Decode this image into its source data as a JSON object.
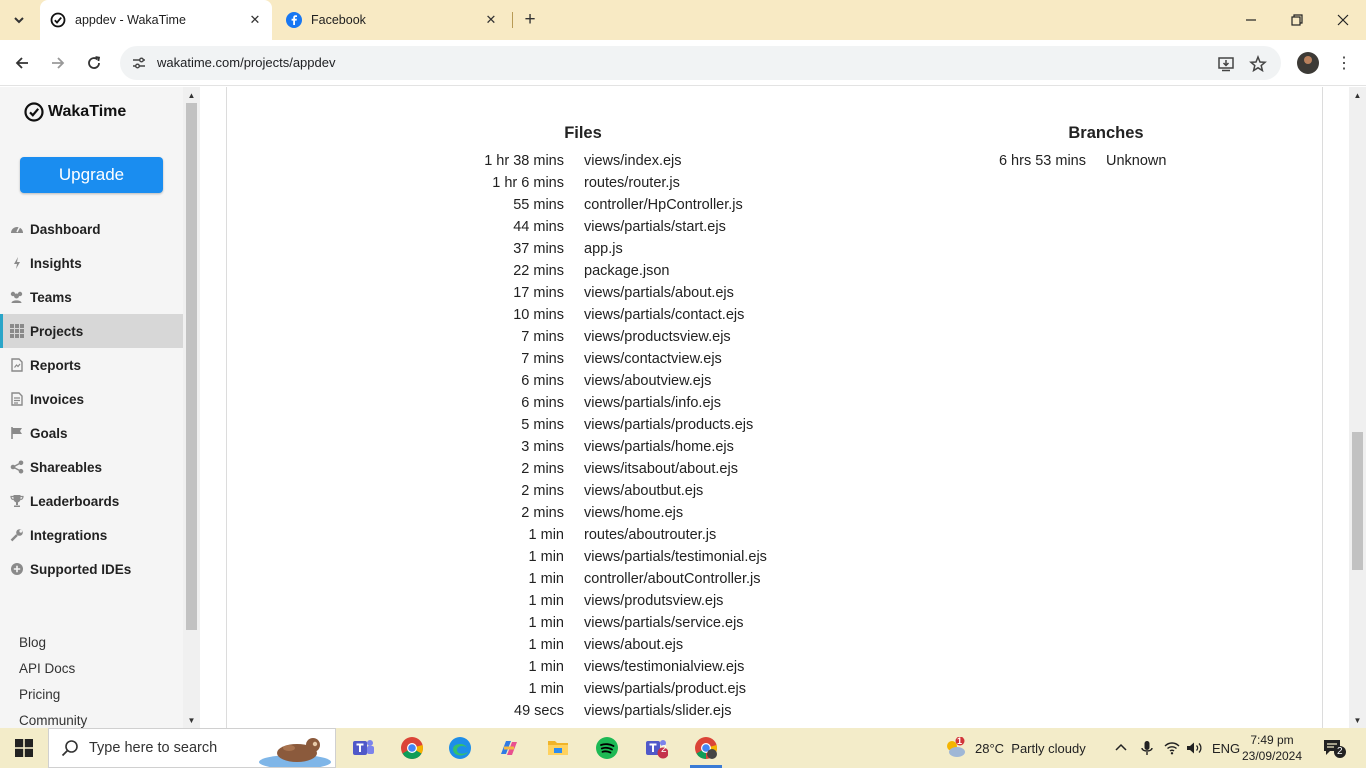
{
  "browser": {
    "tabs": [
      {
        "title": "appdev - WakaTime",
        "active": true
      },
      {
        "title": "Facebook",
        "active": false
      }
    ],
    "url": "wakatime.com/projects/appdev"
  },
  "sidebar": {
    "logo_text": "WakaTime",
    "upgrade_label": "Upgrade",
    "items": [
      {
        "label": "Dashboard",
        "icon": "dashboard-icon"
      },
      {
        "label": "Insights",
        "icon": "bolt-icon"
      },
      {
        "label": "Teams",
        "icon": "users-icon"
      },
      {
        "label": "Projects",
        "icon": "grid-icon",
        "active": true
      },
      {
        "label": "Reports",
        "icon": "report-icon"
      },
      {
        "label": "Invoices",
        "icon": "invoice-icon"
      },
      {
        "label": "Goals",
        "icon": "flag-icon"
      },
      {
        "label": "Shareables",
        "icon": "share-icon"
      },
      {
        "label": "Leaderboards",
        "icon": "trophy-icon"
      },
      {
        "label": "Integrations",
        "icon": "wrench-icon"
      },
      {
        "label": "Supported IDEs",
        "icon": "plus-circle-icon"
      }
    ],
    "footer": [
      "Blog",
      "API Docs",
      "Pricing",
      "Community"
    ]
  },
  "files": {
    "title": "Files",
    "rows": [
      {
        "duration": "1 hr 38 mins",
        "name": "views/index.ejs"
      },
      {
        "duration": "1 hr 6 mins",
        "name": "routes/router.js"
      },
      {
        "duration": "55 mins",
        "name": "controller/HpController.js"
      },
      {
        "duration": "44 mins",
        "name": "views/partials/start.ejs"
      },
      {
        "duration": "37 mins",
        "name": "app.js"
      },
      {
        "duration": "22 mins",
        "name": "package.json"
      },
      {
        "duration": "17 mins",
        "name": "views/partials/about.ejs"
      },
      {
        "duration": "10 mins",
        "name": "views/partials/contact.ejs"
      },
      {
        "duration": "7 mins",
        "name": "views/productsview.ejs"
      },
      {
        "duration": "7 mins",
        "name": "views/contactview.ejs"
      },
      {
        "duration": "6 mins",
        "name": "views/aboutview.ejs"
      },
      {
        "duration": "6 mins",
        "name": "views/partials/info.ejs"
      },
      {
        "duration": "5 mins",
        "name": "views/partials/products.ejs"
      },
      {
        "duration": "3 mins",
        "name": "views/partials/home.ejs"
      },
      {
        "duration": "2 mins",
        "name": "views/itsabout/about.ejs"
      },
      {
        "duration": "2 mins",
        "name": "views/aboutbut.ejs"
      },
      {
        "duration": "2 mins",
        "name": "views/home.ejs"
      },
      {
        "duration": "1 min",
        "name": "routes/aboutrouter.js"
      },
      {
        "duration": "1 min",
        "name": "views/partials/testimonial.ejs"
      },
      {
        "duration": "1 min",
        "name": "controller/aboutController.js"
      },
      {
        "duration": "1 min",
        "name": "views/produtsview.ejs"
      },
      {
        "duration": "1 min",
        "name": "views/partials/service.ejs"
      },
      {
        "duration": "1 min",
        "name": "views/about.ejs"
      },
      {
        "duration": "1 min",
        "name": "views/testimonialview.ejs"
      },
      {
        "duration": "1 min",
        "name": "views/partials/product.ejs"
      },
      {
        "duration": "49 secs",
        "name": "views/partials/slider.ejs"
      }
    ]
  },
  "branches": {
    "title": "Branches",
    "rows": [
      {
        "duration": "6 hrs 53 mins",
        "name": "Unknown"
      }
    ]
  },
  "taskbar": {
    "search_placeholder": "Type here to search",
    "weather": "28°C  Partly cloudy",
    "weather_badge": "1",
    "language": "ENG",
    "time": "7:49 pm",
    "date": "23/09/2024",
    "notification_count": "2",
    "teams_badge": "2"
  },
  "colors": {
    "accent": "#1a8df0",
    "active_nav_border": "#2aa5c8",
    "tabbar_bg": "#f8eac4",
    "taskbar_bg": "#f3ecc9"
  }
}
